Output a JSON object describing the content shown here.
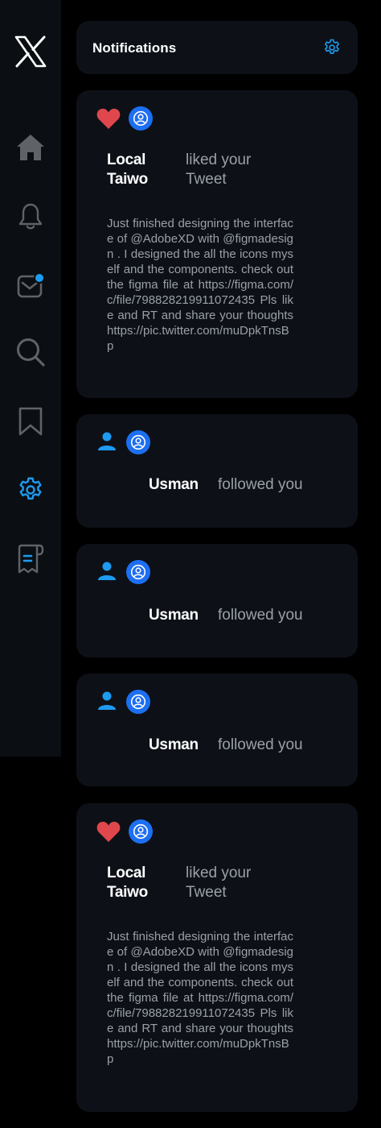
{
  "sidebar": {
    "logo": "x-logo-icon",
    "items": [
      {
        "icon": "home-icon"
      },
      {
        "icon": "bell-icon"
      },
      {
        "icon": "messages-icon"
      },
      {
        "icon": "search-icon"
      },
      {
        "icon": "bookmark-icon"
      },
      {
        "icon": "gear-icon"
      },
      {
        "icon": "lists-icon"
      }
    ]
  },
  "header": {
    "title": "Notifications",
    "settings_icon": "gear-icon"
  },
  "notifications": [
    {
      "type": "like",
      "name": "Local Taiwo",
      "action": "liked your Tweet",
      "text": "Just finished designing the interface of @AdobeXD with @figmadesign . I designed the all the icons myself and the components. check out the figma file at https://figma.com/c/file/798828219911072435 Pls like and RT and share your thoughts https://pic.twitter.com/muDpkTnsBp"
    },
    {
      "type": "follow",
      "name": "Usman",
      "action": "followed you"
    },
    {
      "type": "follow",
      "name": "Usman",
      "action": "followed you"
    },
    {
      "type": "follow",
      "name": "Usman",
      "action": "followed you"
    },
    {
      "type": "like",
      "name": "Local Taiwo",
      "action": "liked your Tweet",
      "text": "Just finished designing the interface of @AdobeXD with @figmadesign . I designed the all the icons myself and the components. check out the figma file at https://figma.com/c/file/798828219911072435 Pls like and RT and share your thoughts https://pic.twitter.com/muDpkTnsBp"
    }
  ],
  "colors": {
    "accent": "#1d9bf0",
    "heart": "#e0474c",
    "avatar": "#1d6ff2",
    "card": "#0d1117",
    "sidebar": "#0b0f14",
    "muted_text": "#9aa0a6"
  }
}
